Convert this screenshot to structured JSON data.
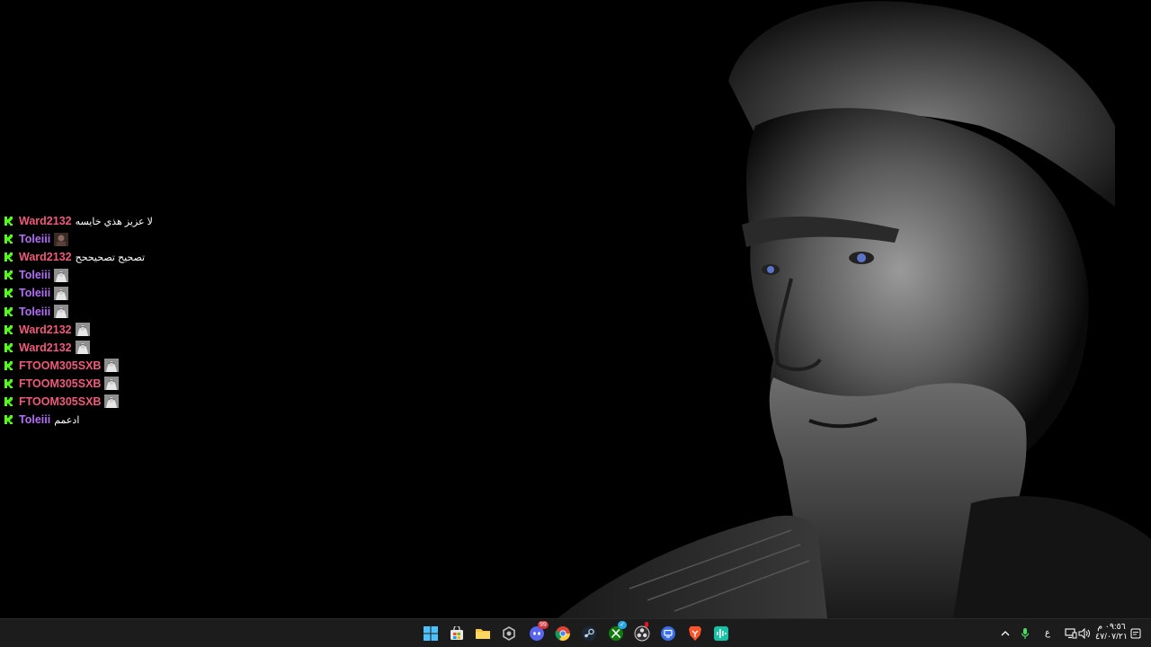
{
  "chat": {
    "messages": [
      {
        "user": "Ward2132",
        "color": "#ef5a7a",
        "text": "لا عزيز هذي خايسه",
        "emote": false,
        "emote_style": ""
      },
      {
        "user": "Toleiii",
        "color": "#b26ff5",
        "text": "",
        "emote": true,
        "emote_style": "dark"
      },
      {
        "user": "Ward2132",
        "color": "#ef5a7a",
        "text": "تصحيح تصحيححح",
        "emote": false,
        "emote_style": ""
      },
      {
        "user": "Toleiii",
        "color": "#b26ff5",
        "text": "",
        "emote": true,
        "emote_style": "light"
      },
      {
        "user": "Toleiii",
        "color": "#b26ff5",
        "text": "",
        "emote": true,
        "emote_style": "light"
      },
      {
        "user": "Toleiii",
        "color": "#b26ff5",
        "text": "",
        "emote": true,
        "emote_style": "light"
      },
      {
        "user": "Ward2132",
        "color": "#ef5a7a",
        "text": "",
        "emote": true,
        "emote_style": "light"
      },
      {
        "user": "Ward2132",
        "color": "#ef5a7a",
        "text": "",
        "emote": true,
        "emote_style": "light"
      },
      {
        "user": "FTOOM305SXB",
        "color": "#ef5a7a",
        "text": "",
        "emote": true,
        "emote_style": "light"
      },
      {
        "user": "FTOOM305SXB",
        "color": "#ef5a7a",
        "text": "",
        "emote": true,
        "emote_style": "light"
      },
      {
        "user": "FTOOM305SXB",
        "color": "#ef5a7a",
        "text": "",
        "emote": true,
        "emote_style": "light"
      },
      {
        "user": "Toleiii",
        "color": "#b26ff5",
        "text": "ادعمم",
        "emote": false,
        "emote_style": ""
      }
    ],
    "platform_icon": "kick-icon",
    "platform_color": "#53fc18"
  },
  "taskbar": {
    "apps": [
      {
        "name": "start-icon"
      },
      {
        "name": "microsoft-store-icon"
      },
      {
        "name": "file-explorer-icon"
      },
      {
        "name": "app-hexagon-icon"
      },
      {
        "name": "discord-icon",
        "badge": "99"
      },
      {
        "name": "chrome-icon"
      },
      {
        "name": "steam-icon"
      },
      {
        "name": "xbox-icon"
      },
      {
        "name": "obs-icon"
      },
      {
        "name": "remote-desktop-icon"
      },
      {
        "name": "brave-icon"
      },
      {
        "name": "voice-app-icon"
      }
    ],
    "tray": {
      "chevron": "chevron-up-icon",
      "mic": "microphone-icon",
      "language": "ع",
      "network": "network-icon",
      "volume": "speaker-icon",
      "time": "٠٩:٥٦ م",
      "date": "٤٧/٠٧/٢١",
      "notifications": "notification-icon"
    }
  }
}
